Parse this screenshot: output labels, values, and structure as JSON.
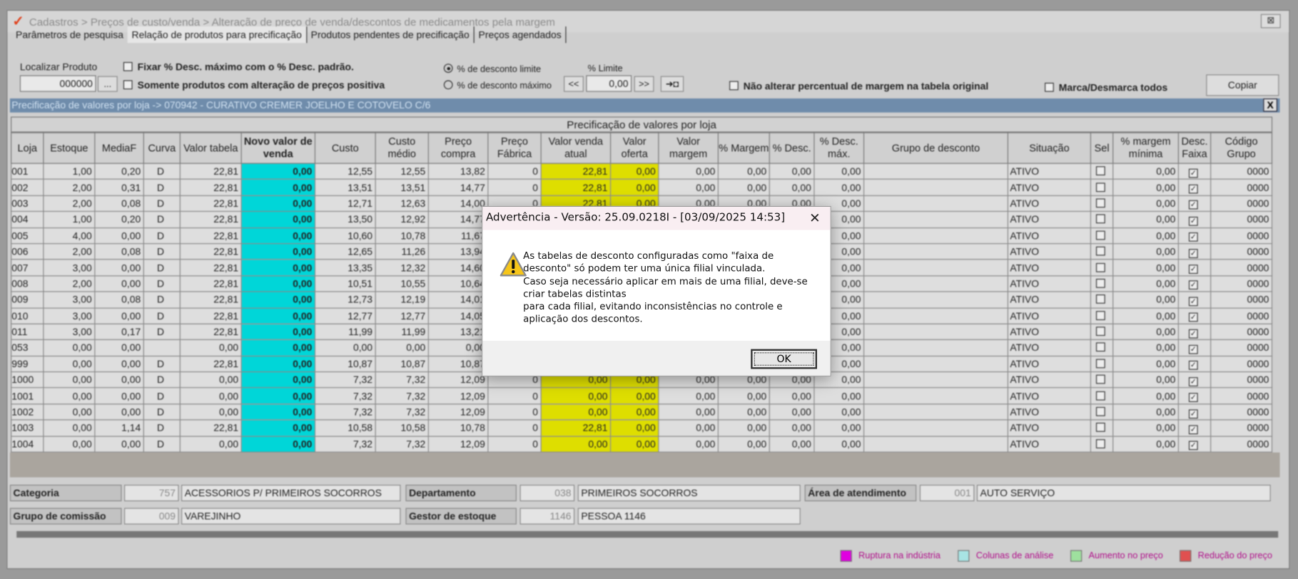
{
  "window": {
    "title": "Cadastros > Preços de custo/venda > Alteração de preço de venda/descontos de medicamentos pela margem",
    "close": "⊠"
  },
  "tabs": [
    "Parâmetros de pesquisa",
    "Relação de produtos para precificação",
    "Produtos pendentes de precificação",
    "Preços agendados"
  ],
  "filters": {
    "localizar_label": "Localizar Produto",
    "localizar_value": "000000",
    "browse": "...",
    "fixar": "Fixar % Desc. máximo com o % Desc. padrão.",
    "somente": "Somente produtos com alteração de preços positiva",
    "radio_limite": "% de desconto limite",
    "radio_maximo": "% de desconto máximo",
    "limite_label": "% Limite",
    "limite_value": "0,00",
    "prev": "<<",
    "next": ">>",
    "apply": "➜◘",
    "nao_alterar": "Não alterar percentual de margem na tabela original",
    "marca": "Marca/Desmarca todos",
    "copiar": "Copiar"
  },
  "panel": {
    "title": "Precificação de valores por loja -> 070942 - CURATIVO CREMER JOELHO E COTOVELO C/6",
    "close": "X",
    "group_header": "Precificação de valores por loja"
  },
  "columns": [
    "Loja",
    "Estoque",
    "MediaF",
    "Curva",
    "Valor tabela",
    "Novo valor de venda",
    "Custo",
    "Custo médio",
    "Preço compra",
    "Preço Fábrica",
    "Valor venda atual",
    "Valor oferta",
    "Valor margem",
    "% Margem",
    "% Desc.",
    "% Desc. máx.",
    "Grupo de desconto",
    "Situação",
    "Sel",
    "% margem mínima",
    "Desc. Faixa",
    "Código Grupo"
  ],
  "rows": [
    [
      "001",
      "1,00",
      "0,20",
      "D",
      "22,81",
      "0,00",
      "12,55",
      "12,55",
      "13,82",
      "0",
      "22,81",
      "0,00",
      "0,00",
      "0,00",
      "0,00",
      "0,00",
      "",
      "ATIVO",
      false,
      "0,00",
      true,
      "0000"
    ],
    [
      "002",
      "2,00",
      "0,31",
      "D",
      "22,81",
      "0,00",
      "13,51",
      "13,51",
      "14,77",
      "0",
      "22,81",
      "0,00",
      "0,00",
      "0,00",
      "0,00",
      "0,00",
      "",
      "ATIVO",
      false,
      "0,00",
      true,
      "0000"
    ],
    [
      "003",
      "2,00",
      "0,08",
      "D",
      "22,81",
      "0,00",
      "12,71",
      "12,63",
      "14,00",
      "0",
      "22,81",
      "0,00",
      "0,00",
      "0,00",
      "0,00",
      "0,00",
      "",
      "ATIVO",
      false,
      "0,00",
      true,
      "0000"
    ],
    [
      "004",
      "1,00",
      "0,20",
      "D",
      "22,81",
      "0,00",
      "13,50",
      "12,92",
      "14,77",
      "",
      "",
      "",
      "",
      "",
      "",
      "0,00",
      "",
      "ATIVO",
      false,
      "0,00",
      true,
      "0000"
    ],
    [
      "005",
      "4,00",
      "0,00",
      "D",
      "22,81",
      "0,00",
      "10,60",
      "10,78",
      "11,67",
      "",
      "",
      "",
      "",
      "",
      "",
      "0,00",
      "",
      "ATIVO",
      false,
      "0,00",
      true,
      "0000"
    ],
    [
      "006",
      "2,00",
      "0,08",
      "D",
      "22,81",
      "0,00",
      "12,65",
      "11,26",
      "13,94",
      "",
      "",
      "",
      "",
      "",
      "",
      "0,00",
      "",
      "ATIVO",
      false,
      "0,00",
      true,
      "0000"
    ],
    [
      "007",
      "3,00",
      "0,00",
      "D",
      "22,81",
      "0,00",
      "13,35",
      "12,32",
      "14,60",
      "",
      "",
      "",
      "",
      "",
      "",
      "0,00",
      "",
      "ATIVO",
      false,
      "0,00",
      true,
      "0000"
    ],
    [
      "008",
      "2,00",
      "0,00",
      "D",
      "22,81",
      "0,00",
      "10,51",
      "10,55",
      "10,64",
      "",
      "",
      "",
      "",
      "",
      "",
      "0,00",
      "",
      "ATIVO",
      false,
      "0,00",
      true,
      "0000"
    ],
    [
      "009",
      "3,00",
      "0,08",
      "D",
      "22,81",
      "0,00",
      "12,73",
      "12,19",
      "14,01",
      "",
      "",
      "",
      "",
      "",
      "",
      "0,00",
      "",
      "ATIVO",
      false,
      "0,00",
      true,
      "0000"
    ],
    [
      "010",
      "3,00",
      "0,00",
      "D",
      "22,81",
      "0,00",
      "12,77",
      "12,77",
      "14,05",
      "",
      "",
      "",
      "",
      "",
      "",
      "0,00",
      "",
      "ATIVO",
      false,
      "0,00",
      true,
      "0000"
    ],
    [
      "011",
      "3,00",
      "0,17",
      "D",
      "22,81",
      "0,00",
      "11,99",
      "11,99",
      "13,21",
      "",
      "",
      "",
      "",
      "",
      "",
      "0,00",
      "",
      "ATIVO",
      false,
      "0,00",
      true,
      "0000"
    ],
    [
      "053",
      "0,00",
      "0,00",
      "",
      "0,00",
      "0,00",
      "0,00",
      "0,00",
      "0,00",
      "",
      "",
      "",
      "",
      "",
      "",
      "0,00",
      "",
      "ATIVO",
      false,
      "0,00",
      true,
      "0000"
    ],
    [
      "999",
      "0,00",
      "0,00",
      "D",
      "22,81",
      "0,00",
      "10,87",
      "10,87",
      "10,87",
      "",
      "",
      "",
      "",
      "",
      "",
      "0,00",
      "",
      "ATIVO",
      false,
      "0,00",
      true,
      "0000"
    ],
    [
      "1000",
      "0,00",
      "0,00",
      "D",
      "0,00",
      "0,00",
      "7,32",
      "7,32",
      "12,09",
      "0",
      "0,00",
      "0,00",
      "0,00",
      "0,00",
      "0,00",
      "0,00",
      "",
      "ATIVO",
      false,
      "0,00",
      true,
      "0000"
    ],
    [
      "1001",
      "0,00",
      "0,00",
      "D",
      "0,00",
      "0,00",
      "7,32",
      "7,32",
      "12,09",
      "0",
      "0,00",
      "0,00",
      "0,00",
      "0,00",
      "0,00",
      "0,00",
      "",
      "ATIVO",
      false,
      "0,00",
      true,
      "0000"
    ],
    [
      "1002",
      "0,00",
      "0,00",
      "D",
      "0,00",
      "0,00",
      "7,32",
      "7,32",
      "12,09",
      "0",
      "0,00",
      "0,00",
      "0,00",
      "0,00",
      "0,00",
      "0,00",
      "",
      "ATIVO",
      false,
      "0,00",
      true,
      "0000"
    ],
    [
      "1003",
      "0,00",
      "1,14",
      "D",
      "22,81",
      "0,00",
      "10,58",
      "10,58",
      "10,78",
      "0",
      "22,81",
      "0,00",
      "0,00",
      "0,00",
      "0,00",
      "0,00",
      "",
      "ATIVO",
      false,
      "0,00",
      true,
      "0000"
    ],
    [
      "1004",
      "0,00",
      "0,00",
      "D",
      "0,00",
      "0,00",
      "7,32",
      "7,32",
      "12,09",
      "0",
      "0,00",
      "0,00",
      "0,00",
      "0,00",
      "0,00",
      "0,00",
      "",
      "ATIVO",
      false,
      "0,00",
      true,
      "0000"
    ]
  ],
  "info": {
    "categoria_label": "Categoria",
    "categoria_code": "757",
    "categoria_name": "ACESSORIOS P/ PRIMEIROS SOCORROS",
    "departamento_label": "Departamento",
    "departamento_code": "038",
    "departamento_name": "PRIMEIROS SOCORROS",
    "area_label": "Área de atendimento",
    "area_code": "001",
    "area_name": "AUTO SERVIÇO",
    "comissao_label": "Grupo de comissão",
    "comissao_code": "009",
    "comissao_name": "VAREJINHO",
    "gestor_label": "Gestor de estoque",
    "gestor_code": "1146",
    "gestor_name": "PESSOA 1146"
  },
  "legend": [
    {
      "label": "Ruptura na indústria",
      "color": "#e000e0"
    },
    {
      "label": "Colunas de análise",
      "color": "#a8e4e4"
    },
    {
      "label": "Aumento no preço",
      "color": "#9ee09e"
    },
    {
      "label": "Redução do preço",
      "color": "#e05050"
    }
  ],
  "dialog": {
    "title": "Advertência - Versão: 25.09.0218I - [03/09/2025 14:53]",
    "message": "As tabelas de desconto configuradas como \"faixa de\ndesconto\" só podem ter uma única filial vinculada.\nCaso seja necessário aplicar em mais de uma filial, deve-se\ncriar tabelas distintas\npara cada filial, evitando inconsistências no controle e\naplicação dos descontos.",
    "ok": "OK",
    "close": "✕"
  }
}
